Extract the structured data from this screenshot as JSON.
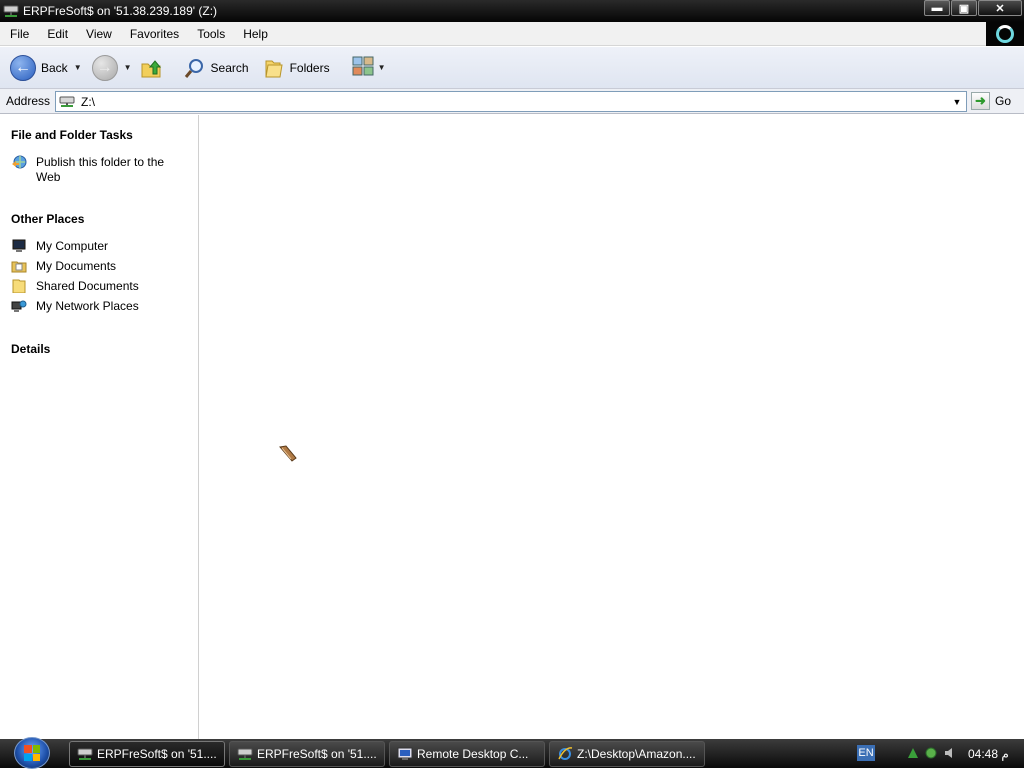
{
  "window": {
    "title": "ERPFreSoft$ on '51.38.239.189' (Z:)",
    "controls": {
      "minimize": "▬",
      "restore": "▣",
      "close": "✕"
    }
  },
  "menubar": {
    "items": [
      "File",
      "Edit",
      "View",
      "Favorites",
      "Tools",
      "Help"
    ]
  },
  "toolbar": {
    "back_label": "Back",
    "search_label": "Search",
    "folders_label": "Folders"
  },
  "address": {
    "label": "Address",
    "value": "Z:\\",
    "go_label": "Go"
  },
  "left_panel": {
    "file_folder_tasks": {
      "title": "File and Folder Tasks",
      "items": [
        {
          "label": "Publish this folder to the Web",
          "icon": "publish-web-icon"
        }
      ]
    },
    "other_places": {
      "title": "Other Places",
      "items": [
        {
          "label": "My Computer",
          "icon": "my-computer-icon"
        },
        {
          "label": "My Documents",
          "icon": "my-documents-icon"
        },
        {
          "label": "Shared Documents",
          "icon": "shared-documents-icon"
        },
        {
          "label": "My Network Places",
          "icon": "network-places-icon"
        }
      ]
    },
    "details": {
      "title": "Details"
    }
  },
  "taskbar": {
    "buttons": [
      {
        "label": "ERPFreSoft$ on '51....",
        "icon": "network-drive-icon",
        "active": true
      },
      {
        "label": "ERPFreSoft$ on '51....",
        "icon": "network-drive-icon",
        "active": false
      },
      {
        "label": "Remote Desktop C...",
        "icon": "remote-desktop-icon",
        "active": false
      },
      {
        "label": "Z:\\Desktop\\Amazon....",
        "icon": "internet-explorer-icon",
        "active": false
      }
    ],
    "language": "EN",
    "clock": "04:48 م"
  }
}
